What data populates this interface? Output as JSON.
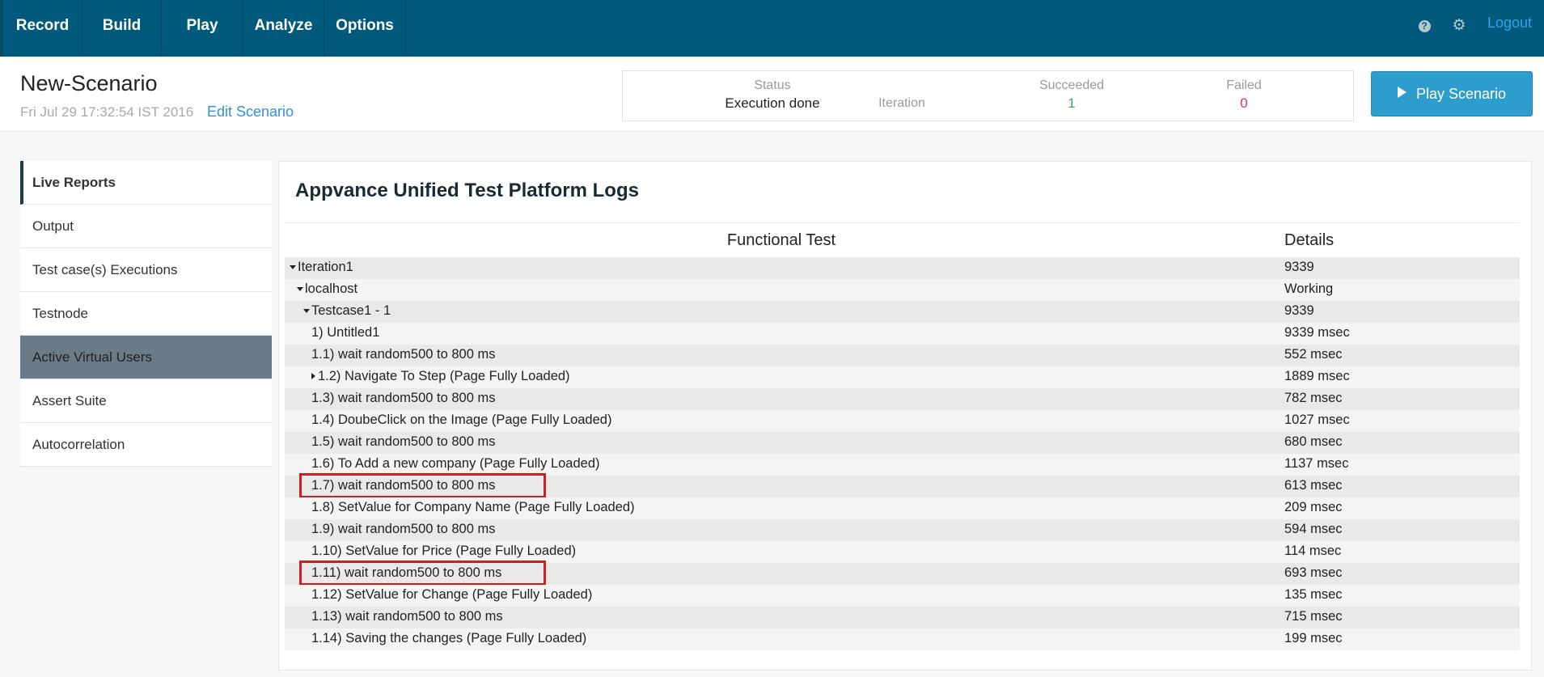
{
  "nav": {
    "items": [
      "Record",
      "Build",
      "Play",
      "Analyze",
      "Options"
    ],
    "help_icon": "question-circle-icon",
    "settings_icon": "gear-icon",
    "logout": "Logout"
  },
  "scenario": {
    "title": "New-Scenario",
    "date": "Fri Jul 29 17:32:54 IST 2016",
    "edit_link": "Edit Scenario"
  },
  "status_panel": {
    "status_label": "Status",
    "status_value": "Execution done",
    "iteration_label": "Iteration",
    "succeeded_label": "Succeeded",
    "succeeded_value": "1",
    "failed_label": "Failed",
    "failed_value": "0",
    "colors": {
      "succeeded": "#3aa76d",
      "failed": "#e0315a"
    }
  },
  "play_button": {
    "label": "Play Scenario",
    "icon": "play-icon"
  },
  "sidebar": {
    "items": [
      {
        "label": "Live Reports",
        "state": "active"
      },
      {
        "label": "Output",
        "state": ""
      },
      {
        "label": "Test case(s) Executions",
        "state": ""
      },
      {
        "label": "Testnode",
        "state": ""
      },
      {
        "label": "Active Virtual Users",
        "state": "selected"
      },
      {
        "label": "Assert Suite",
        "state": ""
      },
      {
        "label": "Autocorrelation",
        "state": ""
      }
    ]
  },
  "logs": {
    "title": "Appvance Unified Test Platform Logs",
    "columns": [
      "Functional Test",
      "Details"
    ],
    "rows": [
      {
        "name": "Iteration1",
        "detail": "9339",
        "indent": 0,
        "toggle": "expanded"
      },
      {
        "name": "localhost",
        "detail": "Working",
        "indent": 1,
        "toggle": "expanded"
      },
      {
        "name": "Testcase1 - 1",
        "detail": "9339",
        "indent": 2,
        "toggle": "expanded"
      },
      {
        "name": "1) Untitled1",
        "detail": "9339 msec",
        "indent": 3,
        "toggle": ""
      },
      {
        "name": "1.1) wait random500 to 800 ms",
        "detail": "552 msec",
        "indent": 3,
        "toggle": ""
      },
      {
        "name": "1.2) Navigate To Step (Page Fully Loaded)",
        "detail": "1889 msec",
        "indent": 3,
        "toggle": "collapsed"
      },
      {
        "name": "1.3) wait random500 to 800 ms",
        "detail": "782 msec",
        "indent": 3,
        "toggle": ""
      },
      {
        "name": "1.4) DoubeClick on the Image (Page Fully Loaded)",
        "detail": "1027 msec",
        "indent": 3,
        "toggle": ""
      },
      {
        "name": "1.5) wait random500 to 800 ms",
        "detail": "680 msec",
        "indent": 3,
        "toggle": ""
      },
      {
        "name": "1.6) To Add a new company (Page Fully Loaded)",
        "detail": "1137 msec",
        "indent": 3,
        "toggle": ""
      },
      {
        "name": "1.7) wait random500 to 800 ms",
        "detail": "613 msec",
        "indent": 3,
        "toggle": "",
        "highlight": true
      },
      {
        "name": "1.8) SetValue for Company Name (Page Fully Loaded)",
        "detail": "209 msec",
        "indent": 3,
        "toggle": ""
      },
      {
        "name": "1.9) wait random500 to 800 ms",
        "detail": "594 msec",
        "indent": 3,
        "toggle": ""
      },
      {
        "name": "1.10) SetValue for Price (Page Fully Loaded)",
        "detail": "114 msec",
        "indent": 3,
        "toggle": ""
      },
      {
        "name": "1.11) wait random500 to 800 ms",
        "detail": "693 msec",
        "indent": 3,
        "toggle": "",
        "highlight": true
      },
      {
        "name": "1.12) SetValue for Change (Page Fully Loaded)",
        "detail": "135 msec",
        "indent": 3,
        "toggle": ""
      },
      {
        "name": "1.13) wait random500 to 800 ms",
        "detail": "715 msec",
        "indent": 3,
        "toggle": ""
      },
      {
        "name": "1.14) Saving the changes (Page Fully Loaded)",
        "detail": "199 msec",
        "indent": 3,
        "toggle": ""
      }
    ]
  }
}
